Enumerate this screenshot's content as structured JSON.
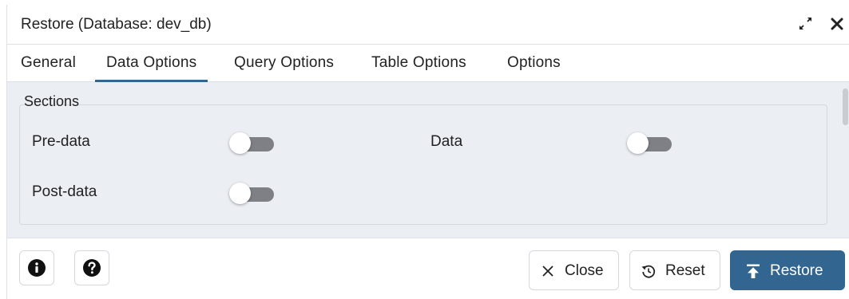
{
  "dialog": {
    "title": "Restore (Database: dev_db)",
    "expand_icon": "expand-icon",
    "close_icon": "close-icon"
  },
  "tabs": [
    {
      "label": "General",
      "active": false
    },
    {
      "label": "Data Options",
      "active": true
    },
    {
      "label": "Query Options",
      "active": false
    },
    {
      "label": "Table Options",
      "active": false
    },
    {
      "label": "Options",
      "active": false
    }
  ],
  "sections": {
    "legend": "Sections",
    "fields": [
      {
        "label": "Pre-data",
        "enabled": false
      },
      {
        "label": "Data",
        "enabled": false
      },
      {
        "label": "Post-data",
        "enabled": false
      }
    ]
  },
  "footer": {
    "info_icon": "info-icon",
    "help_icon": "help-icon",
    "close_label": "Close",
    "reset_label": "Reset",
    "restore_label": "Restore"
  },
  "colors": {
    "accent": "#326690",
    "panel_bg": "#ebeef3",
    "toggle_off": "#7f8086"
  }
}
